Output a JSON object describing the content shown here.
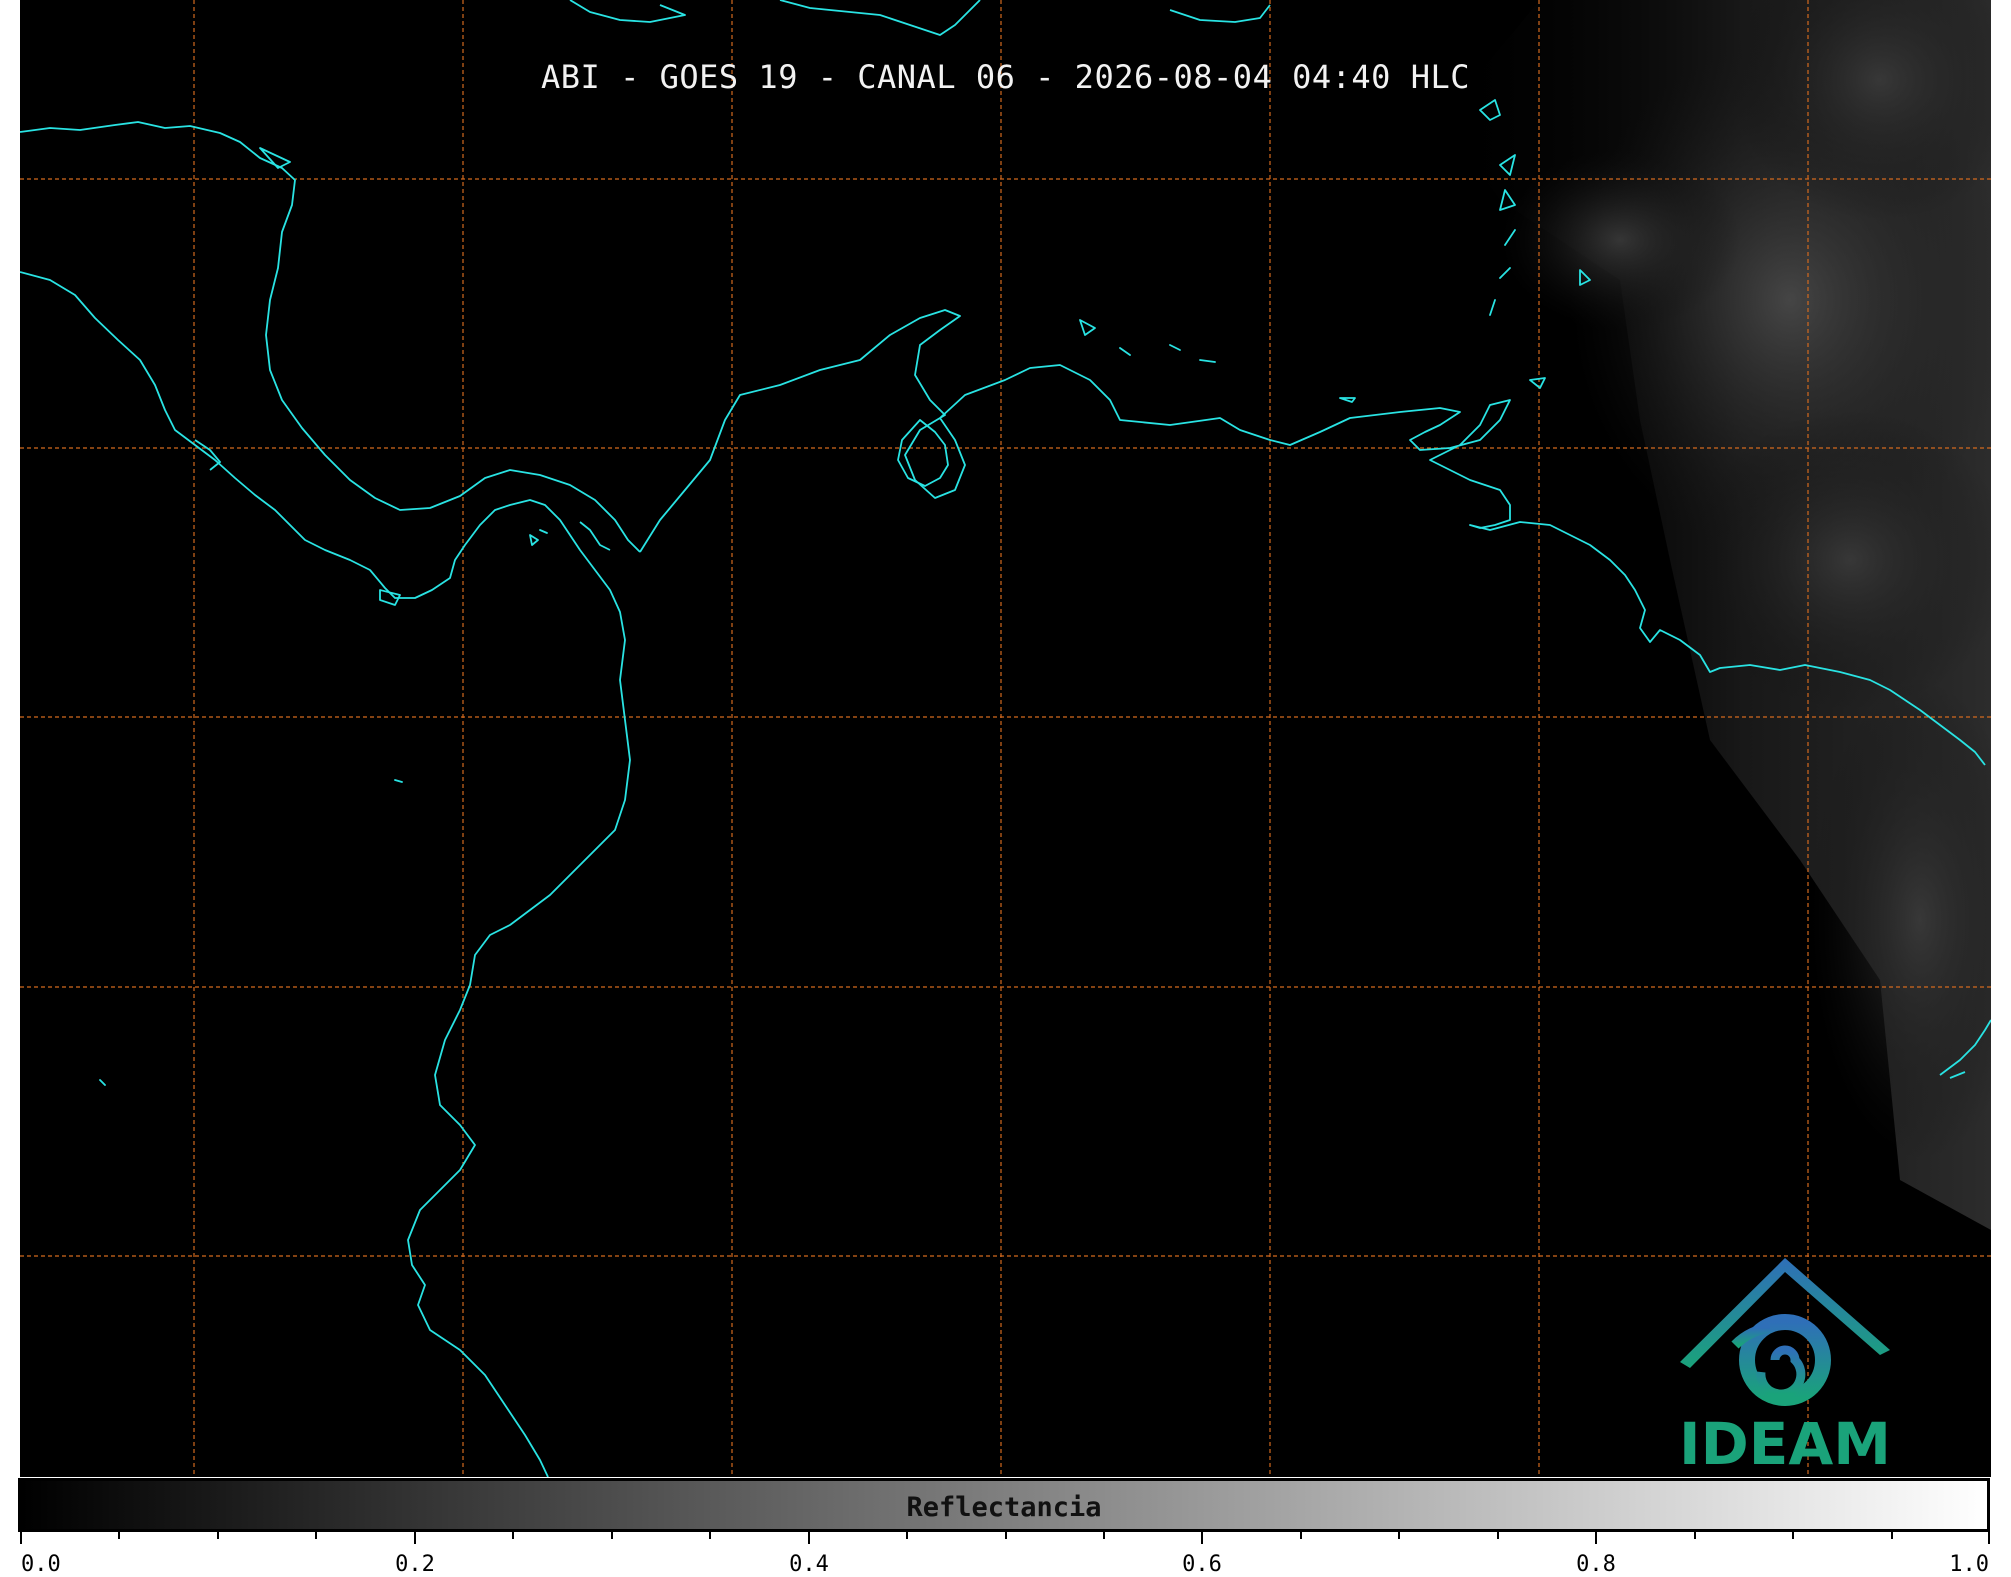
{
  "map": {
    "title": "ABI - GOES 19 - CANAL 06 - 2026-08-04 04:40 HLC",
    "coastline_color": "#29e3e3",
    "grid_color": "#d2691e",
    "background_color": "#000000"
  },
  "logo": {
    "name": "IDEAM",
    "text": "IDEAM",
    "icon": "ideam-logo-icon"
  },
  "colorbar": {
    "label": "Reflectancia",
    "range": [
      0.0,
      1.0
    ],
    "tick_labels": [
      "0.0",
      "0.2",
      "0.4",
      "0.6",
      "0.8",
      "1.0"
    ]
  }
}
